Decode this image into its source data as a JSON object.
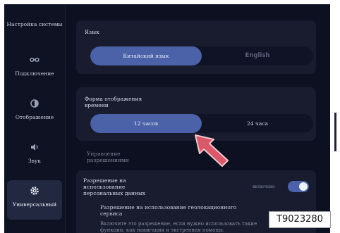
{
  "sidebar": {
    "title": "Настройка системы",
    "items": [
      {
        "label": "Подключение",
        "icon": "link-icon"
      },
      {
        "label": "Отображение",
        "icon": "brightness-icon"
      },
      {
        "label": "Звук",
        "icon": "speaker-icon"
      },
      {
        "label": "Универсальный",
        "icon": "gear-icon",
        "active": true
      }
    ]
  },
  "language": {
    "title": "Язык",
    "options": [
      "Китайский язык",
      "English"
    ],
    "selected": "Китайский язык"
  },
  "time_format": {
    "title": "Форма отображения времени",
    "options": [
      "12 часов",
      "24 часа"
    ],
    "selected": "12 часов"
  },
  "permissions": {
    "section_label": "Управление разрешениями",
    "personal_data_title": "Разрешение на использование персональных данных",
    "personal_data_status": "включено",
    "personal_data_enabled": true,
    "geolocation_title": "Разрешение на использование геолокационного сервиса",
    "geolocation_desc": "Включите это разрешение, если нужно использовать такие функции, как навигация и экстренная помощь."
  },
  "watermark": "T9023280",
  "colors": {
    "accent": "#4b62a8",
    "background": "#0d1020",
    "card": "#181c2e",
    "pointer": "#d9586a"
  }
}
